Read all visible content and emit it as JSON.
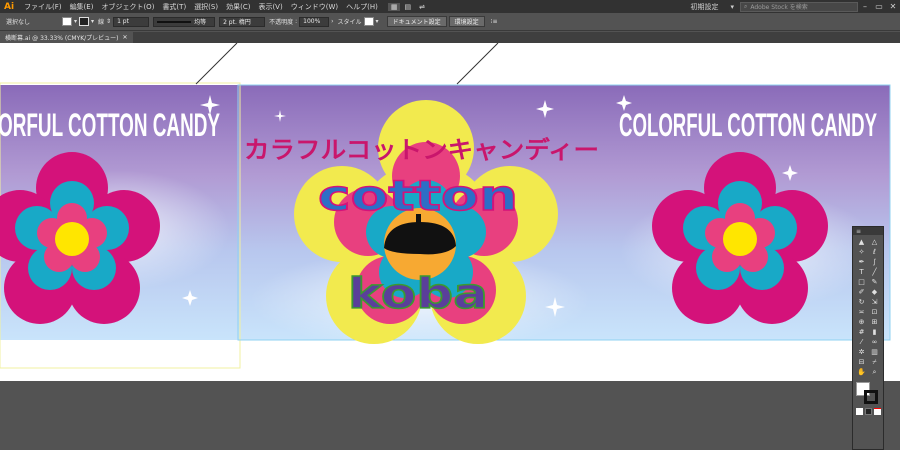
{
  "app": {
    "logo": "Ai"
  },
  "menu": [
    "ファイル(F)",
    "編集(E)",
    "オブジェクト(O)",
    "書式(T)",
    "選択(S)",
    "効果(C)",
    "表示(V)",
    "ウィンドウ(W)",
    "ヘルプ(H)"
  ],
  "header": {
    "workspace": "初期設定",
    "stock_placeholder": "Adobe Stock を検索"
  },
  "control": {
    "selection_label": "選択なし",
    "stroke_label": "線",
    "stroke_weight": "1 pt",
    "profile_label": "均等",
    "brush_label": "2 pt. 楕円",
    "opacity_label": "不透明度",
    "opacity_value": "100%",
    "style_label": "スタイル",
    "doc_settings": "ドキュメント設定",
    "preferences": "環境設定"
  },
  "document": {
    "tab_title": "横断幕.ai @ 33.33% (CMYK/プレビュー)"
  },
  "artwork": {
    "left_title": "ORFUL COTTON CANDY",
    "right_title": "COLORFUL COTTON CANDY",
    "katakana": "カラフルコットンキャンディー",
    "word1": "cotton",
    "word2": "koba"
  },
  "colors": {
    "magenta": "#d4127a",
    "cyan": "#18a9c7",
    "pink": "#e8407f",
    "yellow": "#f2ea4e",
    "center_yellow": "#ffe600",
    "orange": "#f7a932",
    "title_pink": "#c9166c"
  },
  "tools": [
    "selection-tool",
    "direct-selection-tool",
    "magic-wand-tool",
    "lasso-tool",
    "pen-tool",
    "curvature-tool",
    "type-tool",
    "line-segment-tool",
    "rectangle-tool",
    "paintbrush-tool",
    "shaper-tool",
    "eraser-tool",
    "rotate-tool",
    "scale-tool",
    "width-tool",
    "free-transform-tool",
    "shape-builder-tool",
    "perspective-grid-tool",
    "mesh-tool",
    "gradient-tool",
    "eyedropper-tool",
    "blend-tool",
    "symbol-sprayer-tool",
    "column-graph-tool",
    "artboard-tool",
    "slice-tool",
    "hand-tool",
    "zoom-tool"
  ]
}
